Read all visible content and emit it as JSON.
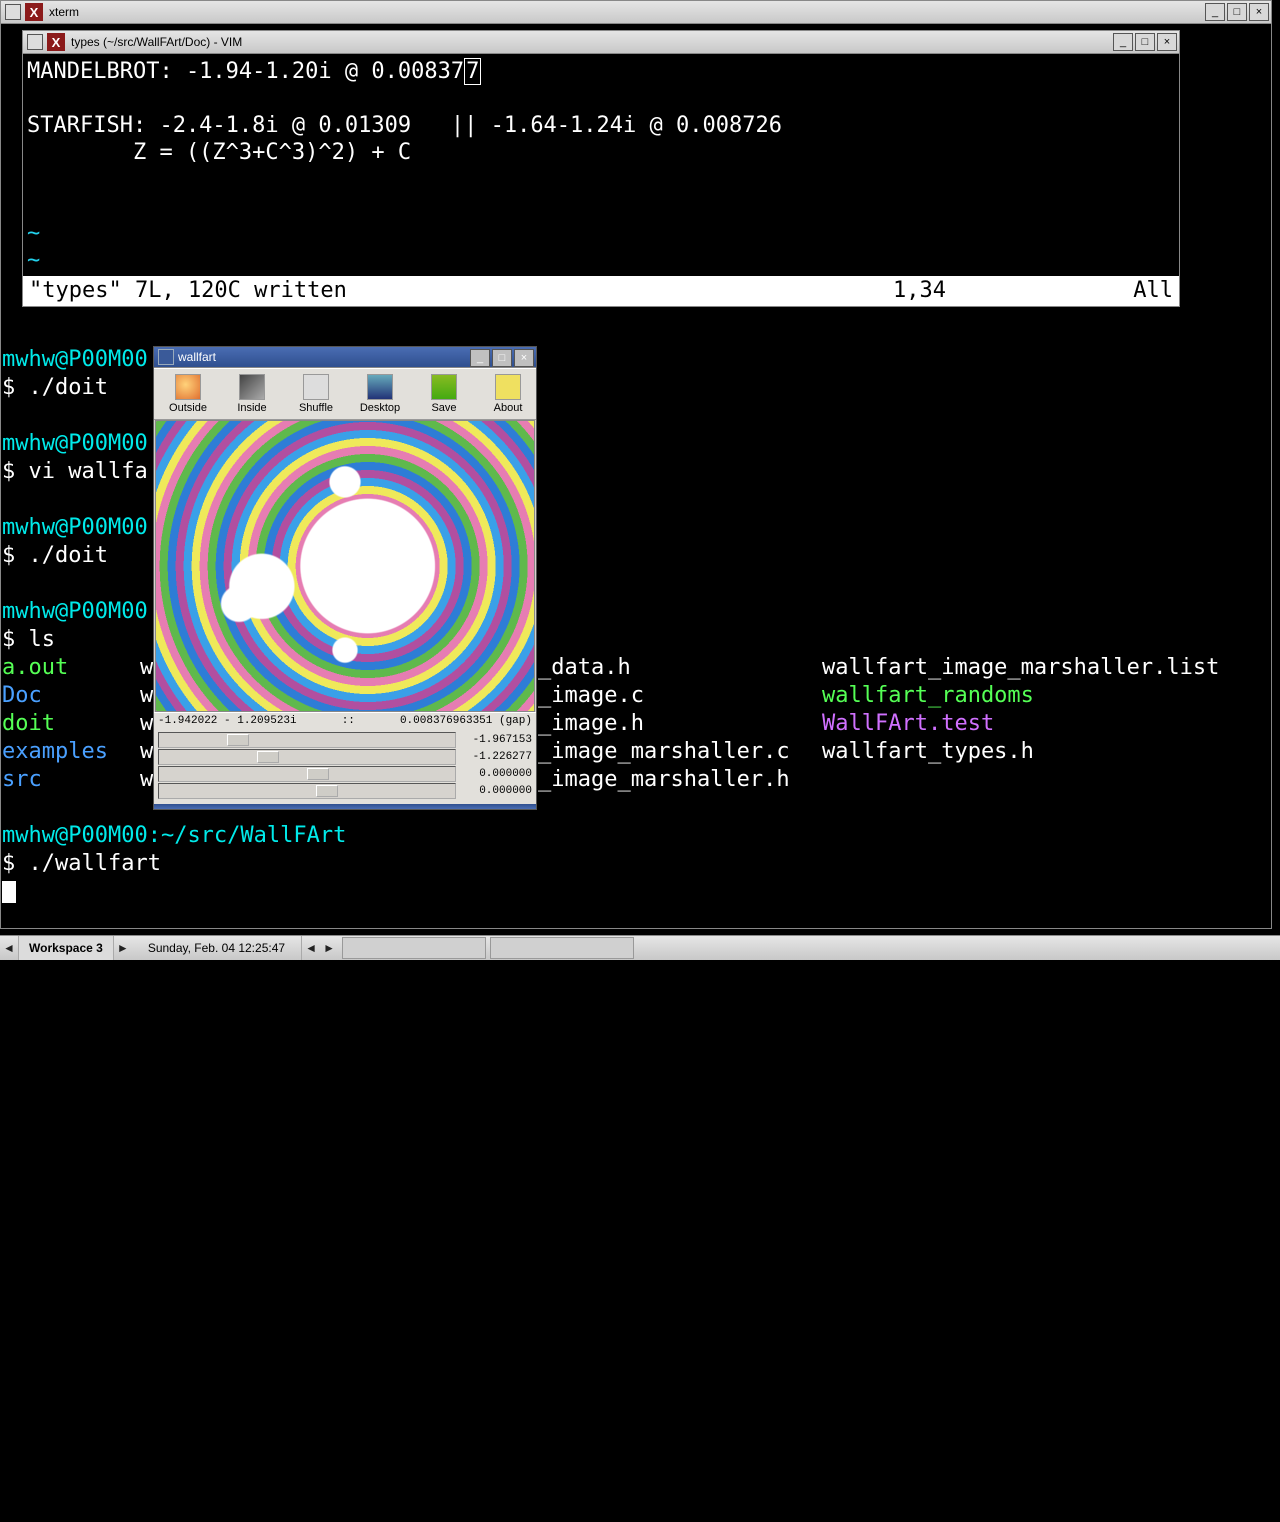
{
  "xterm": {
    "title": "xterm",
    "window_buttons": {
      "min": "_",
      "max": "□",
      "close": "×"
    }
  },
  "vim": {
    "title": "types (~/src/WallFArt/Doc) - VIM",
    "lines": {
      "l1_pre": "MANDELBROT: -1.94-1.20i @ 0.00837",
      "l1_cursor": "7",
      "l2": "",
      "l3": "STARFISH: -2.4-1.8i @ 0.01309   || -1.64-1.24i @ 0.008726",
      "l4": "        Z = ((Z^3+C^3)^2) + C",
      "l5": "",
      "l6": "",
      "tilde": "~"
    },
    "status": {
      "left": "\"types\" 7L, 120C written",
      "mid": "1,34",
      "right": "All"
    }
  },
  "terminal": {
    "prompt_prefix": "mwhw@P00M00",
    "prompt_path": ":~/src/WallFArt",
    "dollar": "$ ",
    "cmds": {
      "c1": "./doit",
      "c2": "vi wallfa",
      "c3": "./doit",
      "c4": "ls",
      "c5": "./wallfart"
    },
    "ls": {
      "col1": [
        "a.out",
        "Doc",
        "doit",
        "examples",
        "src"
      ],
      "col2_cut": [
        "w",
        "w",
        "w",
        "w",
        "w"
      ],
      "col3": [
        "_data.h",
        "_image.c",
        "_image.h",
        "_image_marshaller.c",
        "_image_marshaller.h"
      ],
      "col4": [
        "wallfart_image_marshaller.list",
        "wallfart_randoms",
        "WallFArt.test",
        "wallfart_types.h"
      ]
    }
  },
  "wallfart": {
    "title": "wallfart",
    "toolbar": [
      "Outside",
      "Inside",
      "Shuffle",
      "Desktop",
      "Save",
      "About"
    ],
    "readout": {
      "coord": "-1.942022 - 1.209523i",
      "sep": "::",
      "gap": "0.008376963351 (gap)"
    },
    "sliders": [
      {
        "val": "-1.967153",
        "thumb_pct": 23
      },
      {
        "val": "-1.226277",
        "thumb_pct": 33
      },
      {
        "val": "0.000000",
        "thumb_pct": 50
      },
      {
        "val": "0.000000",
        "thumb_pct": 53
      }
    ]
  },
  "taskbar": {
    "workspace": "Workspace 3",
    "date": "Sunday, Feb. 04   12:25:47",
    "arrows": {
      "l": "◄",
      "r": "►"
    }
  }
}
